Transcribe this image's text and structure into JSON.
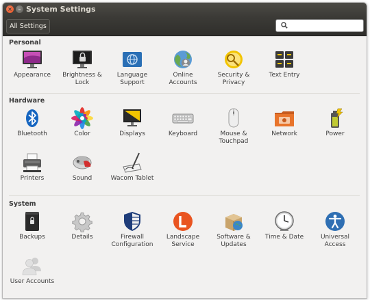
{
  "window": {
    "title": "System Settings"
  },
  "toolbar": {
    "all_settings_label": "All Settings",
    "search_placeholder": ""
  },
  "sections": {
    "personal": {
      "heading": "Personal",
      "items": [
        {
          "label": "Appearance",
          "icon": "appearance-icon"
        },
        {
          "label": "Brightness &\nLock",
          "icon": "brightness-lock-icon"
        },
        {
          "label": "Language\nSupport",
          "icon": "language-support-icon"
        },
        {
          "label": "Online\nAccounts",
          "icon": "online-accounts-icon"
        },
        {
          "label": "Security &\nPrivacy",
          "icon": "security-privacy-icon"
        },
        {
          "label": "Text Entry",
          "icon": "text-entry-icon"
        }
      ]
    },
    "hardware": {
      "heading": "Hardware",
      "items": [
        {
          "label": "Bluetooth",
          "icon": "bluetooth-icon"
        },
        {
          "label": "Color",
          "icon": "color-icon"
        },
        {
          "label": "Displays",
          "icon": "displays-icon"
        },
        {
          "label": "Keyboard",
          "icon": "keyboard-icon"
        },
        {
          "label": "Mouse &\nTouchpad",
          "icon": "mouse-touchpad-icon"
        },
        {
          "label": "Network",
          "icon": "network-icon"
        },
        {
          "label": "Power",
          "icon": "power-icon"
        },
        {
          "label": "Printers",
          "icon": "printers-icon"
        },
        {
          "label": "Sound",
          "icon": "sound-icon"
        },
        {
          "label": "Wacom Tablet",
          "icon": "wacom-tablet-icon"
        }
      ]
    },
    "system": {
      "heading": "System",
      "items": [
        {
          "label": "Backups",
          "icon": "backups-icon"
        },
        {
          "label": "Details",
          "icon": "details-icon"
        },
        {
          "label": "Firewall\nConfiguration",
          "icon": "firewall-icon"
        },
        {
          "label": "Landscape\nService",
          "icon": "landscape-icon"
        },
        {
          "label": "Software &\nUpdates",
          "icon": "software-updates-icon"
        },
        {
          "label": "Time & Date",
          "icon": "time-date-icon"
        },
        {
          "label": "Universal\nAccess",
          "icon": "universal-access-icon"
        },
        {
          "label": "User Accounts",
          "icon": "user-accounts-icon"
        }
      ]
    }
  },
  "colors": {
    "titlebar": "#3c3b37",
    "close_button": "#e95420",
    "background": "#f2f1f0"
  }
}
